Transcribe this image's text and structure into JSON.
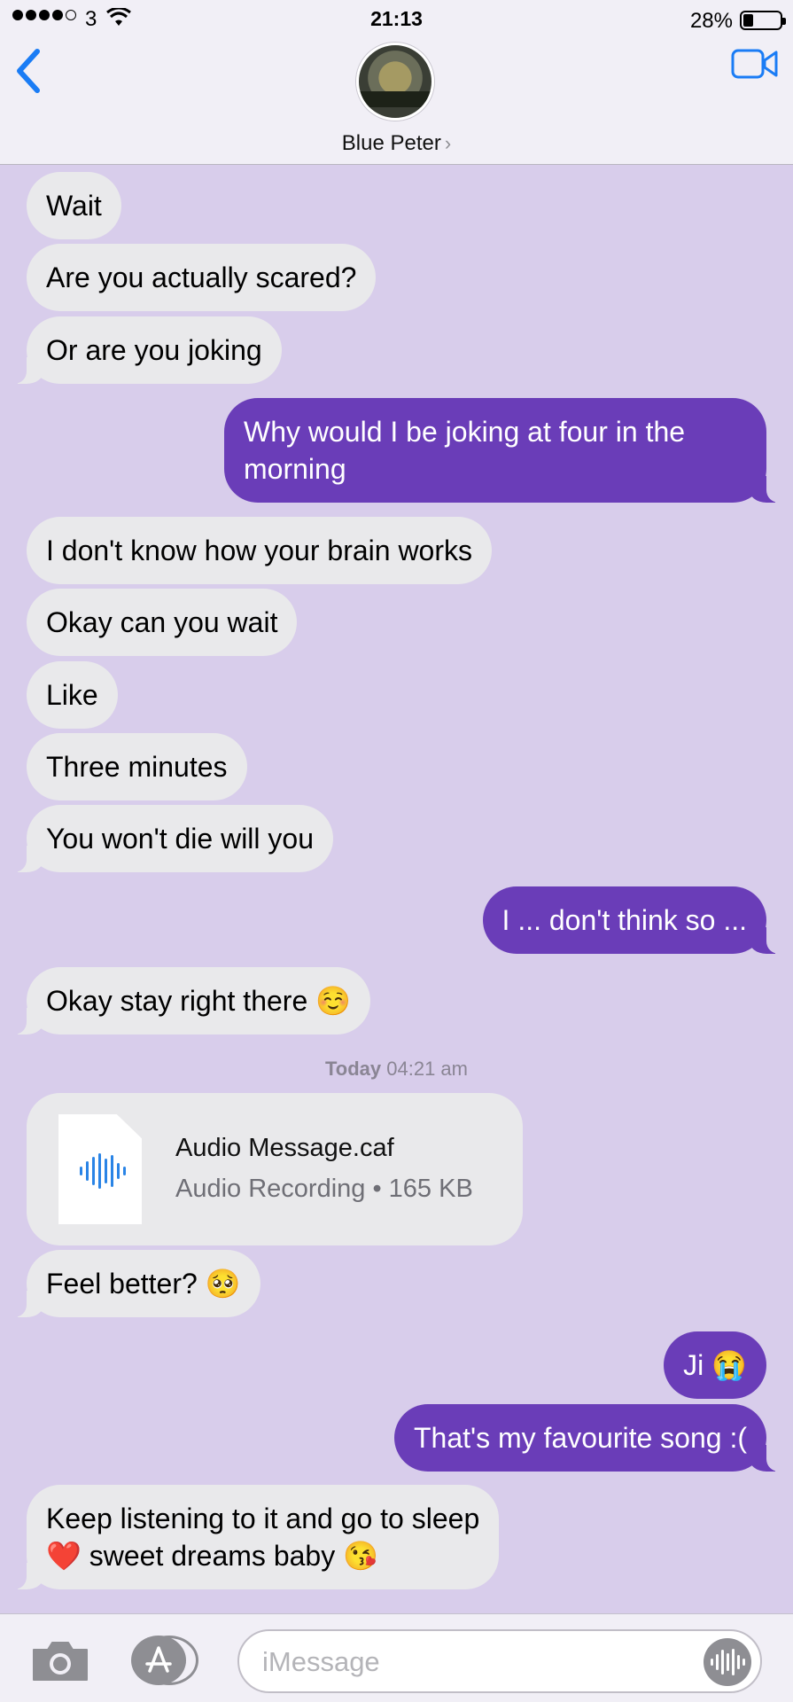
{
  "status_bar": {
    "carrier": "3",
    "time": "21:13",
    "battery": "28%",
    "battery_level": 0.28,
    "signal_bars": 4,
    "signal_total": 5
  },
  "header": {
    "contact_name": "Blue Peter",
    "back_icon": "chevron-left-icon",
    "video_icon": "video-camera-icon"
  },
  "colors": {
    "background": "#d8cdeb",
    "incoming_bubble": "#e9e9eb",
    "outgoing_bubble": "#6a3db8",
    "accent": "#1a7cf5"
  },
  "messages": [
    {
      "from": "them",
      "text": "Wait"
    },
    {
      "from": "them",
      "text": "Are you actually scared?"
    },
    {
      "from": "them",
      "text": "Or are you joking"
    },
    {
      "from": "me",
      "text": "Why would I be joking at four in the morning"
    },
    {
      "from": "them",
      "text": "I don't know how your brain works"
    },
    {
      "from": "them",
      "text": "Okay can you wait"
    },
    {
      "from": "them",
      "text": "Like"
    },
    {
      "from": "them",
      "text": "Three minutes"
    },
    {
      "from": "them",
      "text": "You won't die will you"
    },
    {
      "from": "me",
      "text": "I ... don't think so ..."
    },
    {
      "from": "them",
      "text": "Okay stay right there ☺️"
    }
  ],
  "timestamp": {
    "day": "Today",
    "time": "04:21 am"
  },
  "attachment": {
    "name": "Audio Message.caf",
    "meta": "Audio Recording • 165 KB",
    "icon": "audio-waveform-icon"
  },
  "messages_after": [
    {
      "from": "them",
      "text": "Feel better? 🥺"
    },
    {
      "from": "me",
      "text": "Ji 😭"
    },
    {
      "from": "me",
      "text": "That's my favourite song :("
    },
    {
      "from": "them",
      "text_line1": "Keep listening to it and go to sleep",
      "text_line2": "❤️ sweet dreams baby 😘"
    }
  ],
  "input_bar": {
    "placeholder": "iMessage",
    "camera_icon": "camera-icon",
    "apps_icon": "app-store-icon",
    "audio_icon": "audio-record-icon"
  }
}
